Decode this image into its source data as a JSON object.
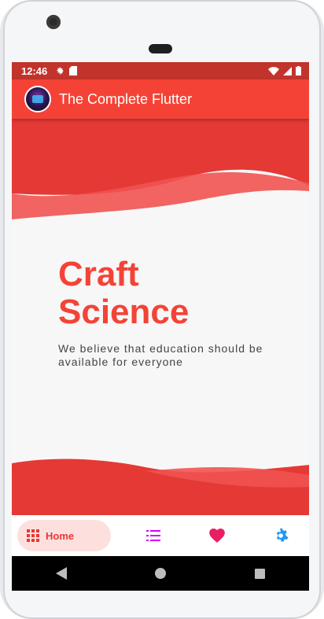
{
  "status_bar": {
    "time": "12:46"
  },
  "app_bar": {
    "title": "The Complete Flutter"
  },
  "hero": {
    "headline_line1": "Craft",
    "headline_line2": "Science",
    "tagline": "We believe that education should be available for everyone"
  },
  "bottom_nav": {
    "items": [
      {
        "label": "Home",
        "icon": "grid-icon",
        "selected": true,
        "color": "#e53935"
      },
      {
        "icon": "list-icon",
        "color": "#d500f9"
      },
      {
        "icon": "heart-icon",
        "color": "#e91e63"
      },
      {
        "icon": "gear-icon",
        "color": "#2196f3"
      }
    ]
  },
  "colors": {
    "primary": "#f44336",
    "status": "#c2332b",
    "wave": "#e53935",
    "wave_light": "#ef5350"
  }
}
